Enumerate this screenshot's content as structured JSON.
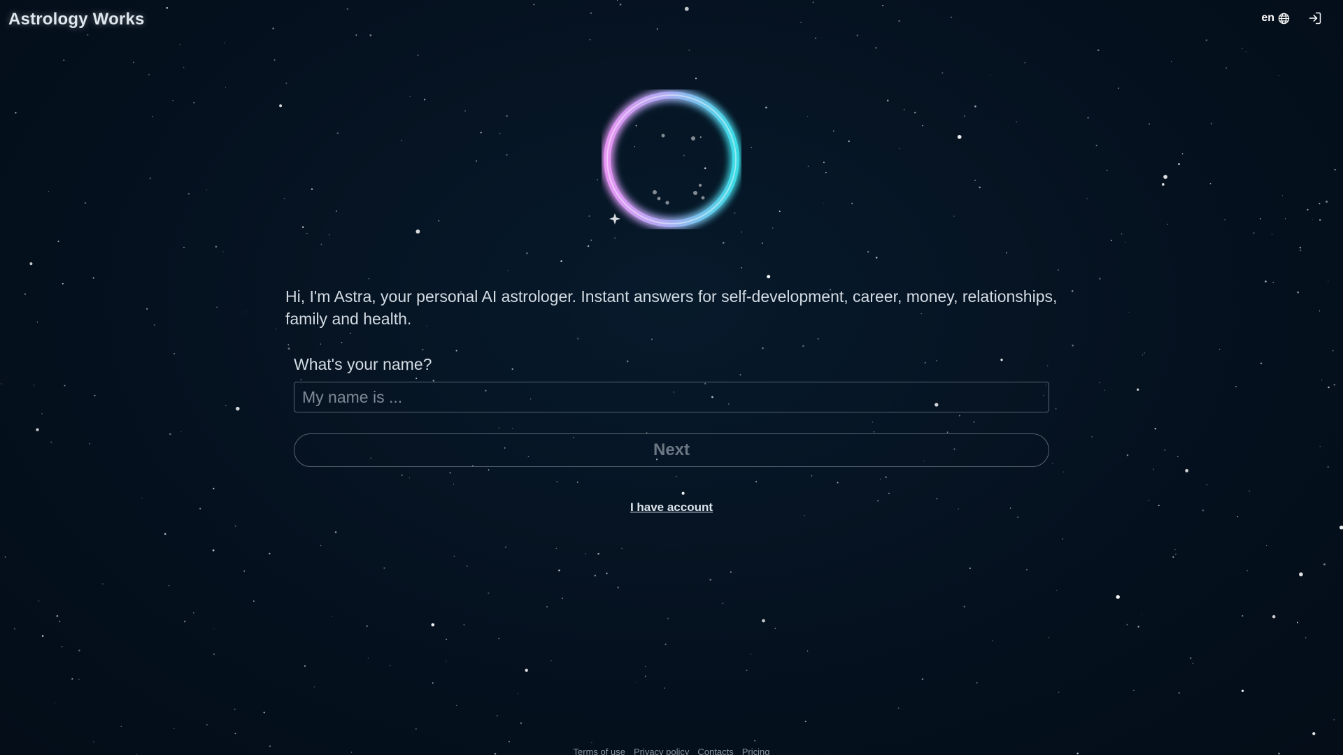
{
  "header": {
    "brand": "Astrology Works",
    "language": "en",
    "language_icon": "globe-icon",
    "login_icon": "login-icon"
  },
  "main": {
    "intro": "Hi, I'm Astra, your personal AI astrologer. Instant answers for self-development, career, money, relationships, family and health.",
    "name_label": "What's your name?",
    "name_placeholder": "My name is ...",
    "name_value": "",
    "next_label": "Next",
    "account_link": "I have account"
  },
  "footer": {
    "links": [
      "Terms of use",
      "Privacy policy",
      "Contacts",
      "Pricing"
    ]
  },
  "colors": {
    "background": "#05111f",
    "orb_pink": "#e28bff",
    "orb_cyan": "#3ee6f0",
    "text": "#d3dbe3"
  }
}
